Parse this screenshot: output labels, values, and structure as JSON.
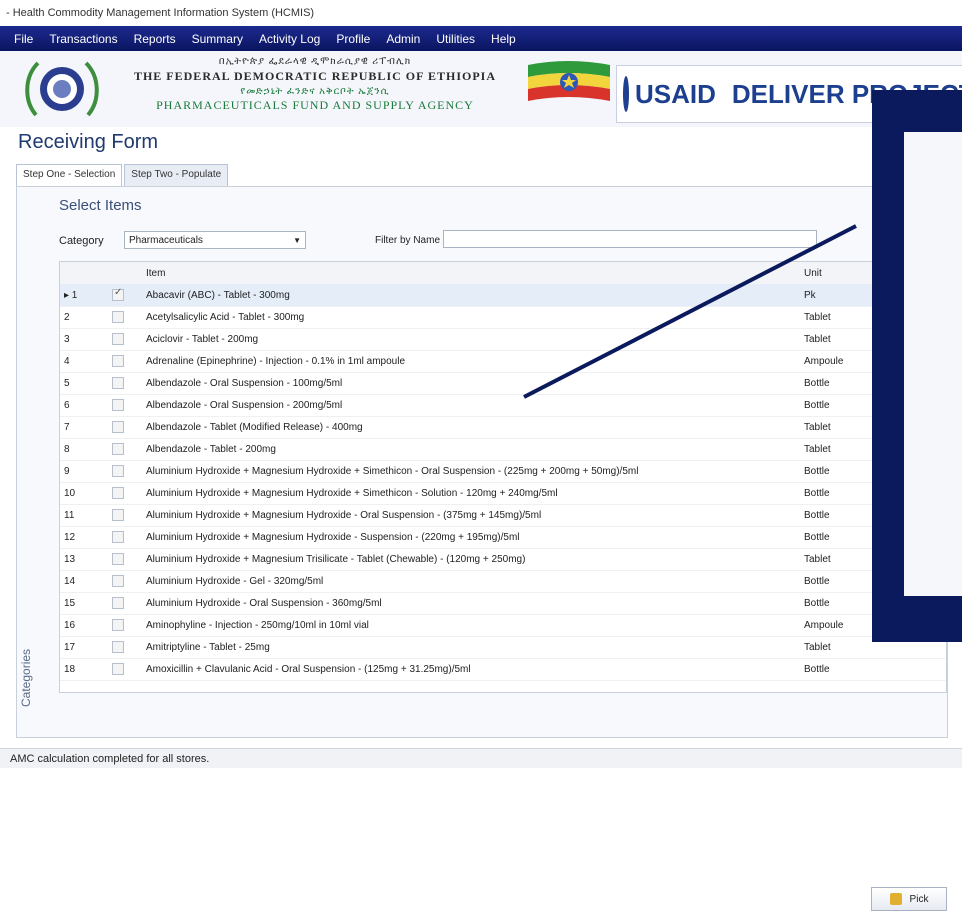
{
  "window": {
    "title": "- Health Commodity Management Information System (HCMIS)"
  },
  "menu": [
    "File",
    "Transactions",
    "Reports",
    "Summary",
    "Activity Log",
    "Profile",
    "Admin",
    "Utilities",
    "Help"
  ],
  "banner": {
    "amharic_line1": "በኢትዮጵያ ፌደራላዊ ዲሞክራሲያዊ ሪፐብሊክ",
    "country": "THE FEDERAL DEMOCRATIC REPUBLIC OF ETHIOPIA",
    "amharic_line2": "የመድኃኒት ፈንድና አቅርቦት ኤጀንሲ",
    "agency": "PHARMACEUTICALS FUND AND SUPPLY AGENCY",
    "usaid": "USAID",
    "project": "DELIVER PROJECT"
  },
  "form": {
    "title": "Receiving Form"
  },
  "tabs": [
    {
      "label": "Step One - Selection"
    },
    {
      "label": "Step Two - Populate"
    }
  ],
  "select_items": {
    "heading": "Select Items",
    "category_label": "Category",
    "category_value": "Pharmaceuticals",
    "filter_label": "Filter by Name",
    "filter_value": ""
  },
  "side_panel": {
    "label": "Categories"
  },
  "grid": {
    "headers": {
      "item": "Item",
      "unit": "Unit"
    },
    "rows": [
      {
        "num": "1",
        "checked": true,
        "item": "Abacavir (ABC) - Tablet - 300mg",
        "unit": "Pk"
      },
      {
        "num": "2",
        "checked": false,
        "item": "Acetylsalicylic Acid - Tablet - 300mg",
        "unit": "Tablet"
      },
      {
        "num": "3",
        "checked": false,
        "item": "Aciclovir - Tablet - 200mg",
        "unit": "Tablet"
      },
      {
        "num": "4",
        "checked": false,
        "item": "Adrenaline (Epinephrine) - Injection - 0.1% in 1ml ampoule",
        "unit": "Ampoule"
      },
      {
        "num": "5",
        "checked": false,
        "item": "Albendazole - Oral Suspension - 100mg/5ml",
        "unit": "Bottle"
      },
      {
        "num": "6",
        "checked": false,
        "item": "Albendazole - Oral Suspension - 200mg/5ml",
        "unit": "Bottle"
      },
      {
        "num": "7",
        "checked": false,
        "item": "Albendazole - Tablet (Modified Release) - 400mg",
        "unit": "Tablet"
      },
      {
        "num": "8",
        "checked": false,
        "item": "Albendazole - Tablet - 200mg",
        "unit": "Tablet"
      },
      {
        "num": "9",
        "checked": false,
        "item": "Aluminium Hydroxide + Magnesium Hydroxide + Simethicon - Oral Suspension - (225mg + 200mg + 50mg)/5ml",
        "unit": "Bottle"
      },
      {
        "num": "10",
        "checked": false,
        "item": "Aluminium Hydroxide + Magnesium Hydroxide + Simethicon - Solution - 120mg + 240mg/5ml",
        "unit": "Bottle"
      },
      {
        "num": "11",
        "checked": false,
        "item": "Aluminium Hydroxide + Magnesium Hydroxide - Oral Suspension - (375mg + 145mg)/5ml",
        "unit": "Bottle"
      },
      {
        "num": "12",
        "checked": false,
        "item": "Aluminium Hydroxide + Magnesium Hydroxide - Suspension - (220mg + 195mg)/5ml",
        "unit": "Bottle"
      },
      {
        "num": "13",
        "checked": false,
        "item": "Aluminium Hydroxide + Magnesium Trisilicate - Tablet (Chewable) - (120mg + 250mg)",
        "unit": "Tablet"
      },
      {
        "num": "14",
        "checked": false,
        "item": "Aluminium Hydroxide - Gel - 320mg/5ml",
        "unit": "Bottle"
      },
      {
        "num": "15",
        "checked": false,
        "item": "Aluminium Hydroxide - Oral Suspension - 360mg/5ml",
        "unit": "Bottle"
      },
      {
        "num": "16",
        "checked": false,
        "item": "Aminophyline - Injection - 250mg/10ml in 10ml vial",
        "unit": "Ampoule"
      },
      {
        "num": "17",
        "checked": false,
        "item": "Amitriptyline - Tablet - 25mg",
        "unit": "Tablet"
      },
      {
        "num": "18",
        "checked": false,
        "item": "Amoxicillin + Clavulanic Acid - Oral Suspension - (125mg + 31.25mg)/5ml",
        "unit": "Bottle"
      }
    ]
  },
  "buttons": {
    "pick": "Pick"
  },
  "status": "AMC calculation completed for all stores.",
  "colors": {
    "menubar": "#0a1560",
    "overlay": "#0b1a5c",
    "title": "#1f3a6e"
  }
}
